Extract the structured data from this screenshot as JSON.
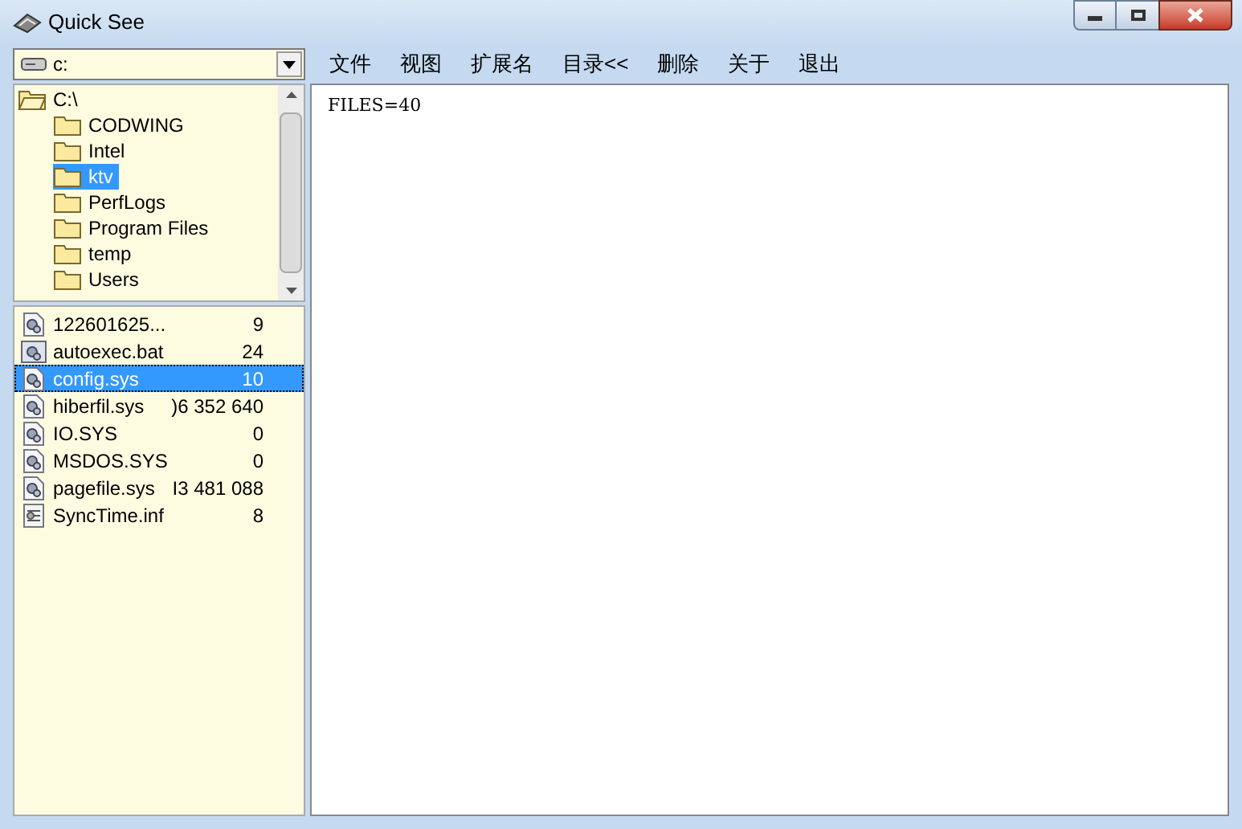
{
  "window": {
    "title": "Quick See"
  },
  "drive_select": {
    "value": "c:"
  },
  "menu": [
    {
      "label": "文件"
    },
    {
      "label": "视图"
    },
    {
      "label": "扩展名"
    },
    {
      "label": "目录<<"
    },
    {
      "label": "删除"
    },
    {
      "label": "关于"
    },
    {
      "label": "退出"
    }
  ],
  "tree": [
    {
      "label": "C:\\",
      "selected": false,
      "children": [
        {
          "label": "CODWING",
          "selected": false
        },
        {
          "label": "Intel",
          "selected": false
        },
        {
          "label": "ktv",
          "selected": true
        },
        {
          "label": "PerfLogs",
          "selected": false
        },
        {
          "label": "Program Files",
          "selected": false
        },
        {
          "label": "temp",
          "selected": false
        },
        {
          "label": "Users",
          "selected": false
        }
      ]
    }
  ],
  "files": [
    {
      "name": "122601625...",
      "size": "9",
      "kind": "system",
      "selected": false
    },
    {
      "name": "autoexec.bat",
      "size": "24",
      "kind": "batch",
      "selected": false
    },
    {
      "name": "config.sys",
      "size": "10",
      "kind": "system",
      "selected": true
    },
    {
      "name": "hiberfil.sys",
      "size": ")6 352 640",
      "kind": "system",
      "selected": false
    },
    {
      "name": "IO.SYS",
      "size": "0",
      "kind": "system",
      "selected": false
    },
    {
      "name": "MSDOS.SYS",
      "size": "0",
      "kind": "system",
      "selected": false
    },
    {
      "name": "pagefile.sys",
      "size": "I3 481 088",
      "kind": "system",
      "selected": false
    },
    {
      "name": "SyncTime.inf",
      "size": "8",
      "kind": "settings",
      "selected": false
    }
  ],
  "content": {
    "text": "FILES=40"
  }
}
